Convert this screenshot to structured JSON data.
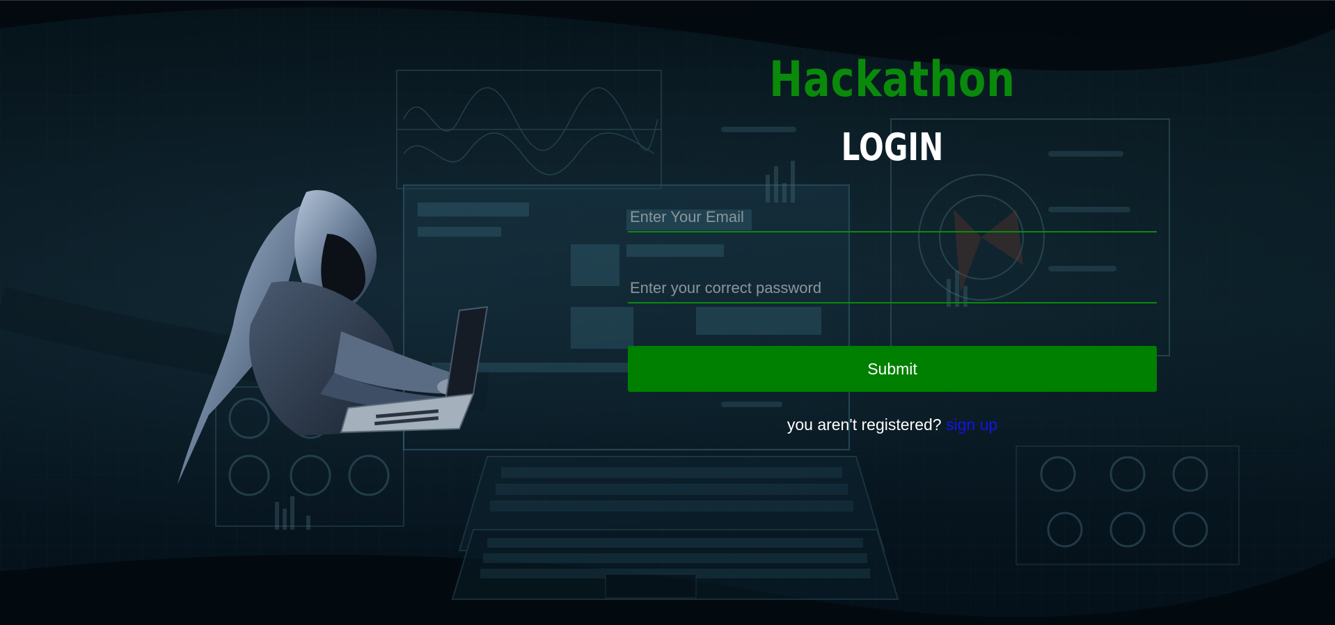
{
  "header": {
    "brand": "Hackathon",
    "heading": "LOGIN"
  },
  "form": {
    "email_placeholder": "Enter Your Email",
    "email_value": "",
    "password_placeholder": "Enter your correct password",
    "password_value": "",
    "submit_label": "Submit"
  },
  "footer": {
    "register_prompt": "you aren't registered?",
    "signup_label": "sign up"
  },
  "colors": {
    "brand": "#0a8a0a",
    "accent": "#008000",
    "link": "#1414e6",
    "heading": "#ffffff"
  },
  "icons": {
    "background": "cyber-dashboard-background",
    "illustration": "hooded-hacker-laptop-illustration"
  }
}
